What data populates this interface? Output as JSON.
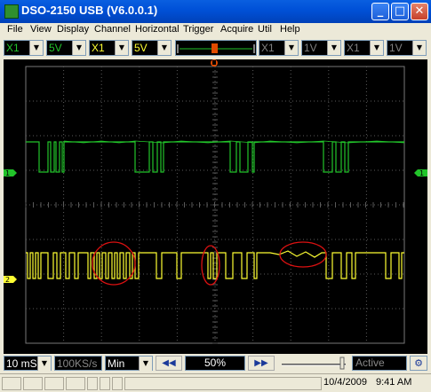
{
  "window": {
    "title": "DSO-2150 USB (V6.0.0.1)"
  },
  "title_buttons": {
    "minimize": "_",
    "maximize": "□",
    "close": "✕"
  },
  "menu": [
    "File",
    "View",
    "Display",
    "Channel",
    "Horizontal",
    "Trigger",
    "Acquire",
    "Util",
    "Help"
  ],
  "toolbar": {
    "ch1_probe": "X1",
    "ch1_voltdiv": "5V",
    "ch2_probe": "X1",
    "ch2_voltdiv": "5V",
    "ch3_probe": "X1",
    "ch3_voltdiv": "1V",
    "ch4_probe": "X1",
    "ch4_voltdiv": "1V"
  },
  "colors": {
    "ch1": "#22c42a",
    "ch2": "#ffff33",
    "grid": "#5a5a5a",
    "annotation": "#dd1111",
    "trigger_marker": "#e04a00"
  },
  "scope": {
    "ch1_marker": "1",
    "ch2_marker": "2",
    "ch1_right_marker": "1",
    "trigger_marker": "T"
  },
  "bottom": {
    "timebase": "10 mS",
    "sample_rate": "100KS/s",
    "mode": "Min",
    "position": "50%",
    "state": "Active"
  },
  "status": {
    "date": "10/4/2009",
    "time": "9:41 AM"
  }
}
